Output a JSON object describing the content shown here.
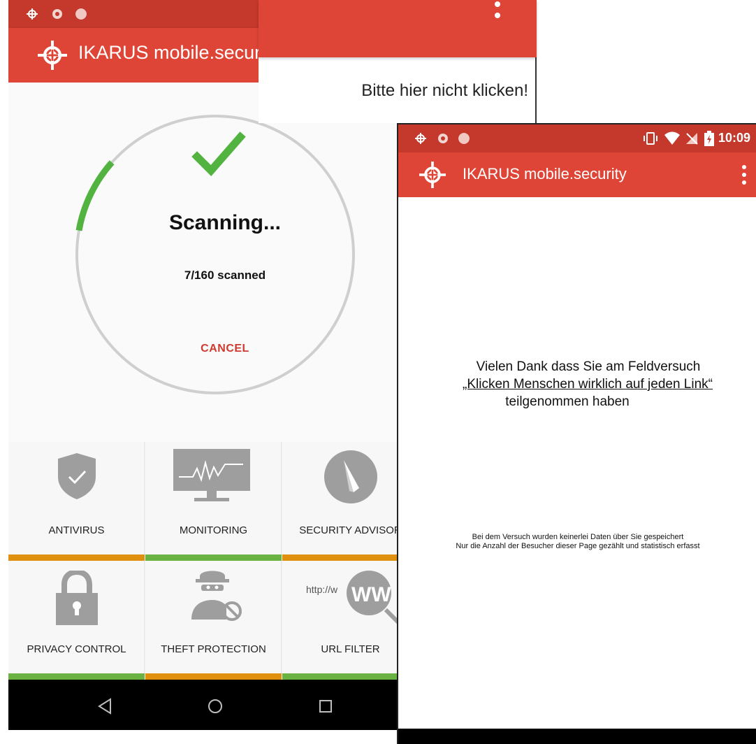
{
  "colors": {
    "primary_red": "#df4536",
    "status_red": "#c4392b",
    "check_green": "#53b340",
    "ring_gray": "#c9c9c9",
    "tile_icon_gray": "#9e9e9e",
    "bar_orange": "#e0900f",
    "bar_green": "#6ab343",
    "cancel_red": "#cc3b2e"
  },
  "screen1": {
    "app_title": "IKARUS mobile.security",
    "scan": {
      "title": "Scanning...",
      "count_text": "7/160 scanned",
      "cancel_label": "CANCEL",
      "progress_fraction": 0.044,
      "status_icon": "check-mark-icon"
    },
    "tiles": [
      {
        "label": "ANTIVIRUS",
        "icon": "shield-check-icon",
        "status": "orange"
      },
      {
        "label": "MONITORING",
        "icon": "monitor-pulse-icon",
        "status": "green"
      },
      {
        "label": "SECURITY ADVISOR",
        "icon": "compass-icon",
        "status": "orange"
      },
      {
        "label": "PRIVACY CONTROL",
        "icon": "padlock-icon",
        "status": "green"
      },
      {
        "label": "THEFT PROTECTION",
        "icon": "thief-icon",
        "status": "orange"
      },
      {
        "label": "URL FILTER",
        "icon": "www-magnifier-icon",
        "status": "green",
        "icon_text": "http://w",
        "badge_text": "WW"
      }
    ],
    "navbar": [
      "back-icon",
      "home-icon",
      "recents-icon"
    ]
  },
  "browser_strip": {
    "link_text": "Bitte hier nicht klicken!"
  },
  "screen2": {
    "app_title": "IKARUS mobile.security",
    "time": "10:09",
    "thanks": {
      "line1": "Vielen Dank dass Sie am Feldversuch",
      "line2": "„Klicken Menschen wirklich auf jeden Link“",
      "line3": "teilgenommen haben"
    },
    "notice": {
      "line1": "Bei dem Versuch wurden keinerlei Daten über Sie gespeichert",
      "line2": "Nur die Anzahl der Besucher dieser Page gezählt und statistisch erfasst"
    }
  }
}
